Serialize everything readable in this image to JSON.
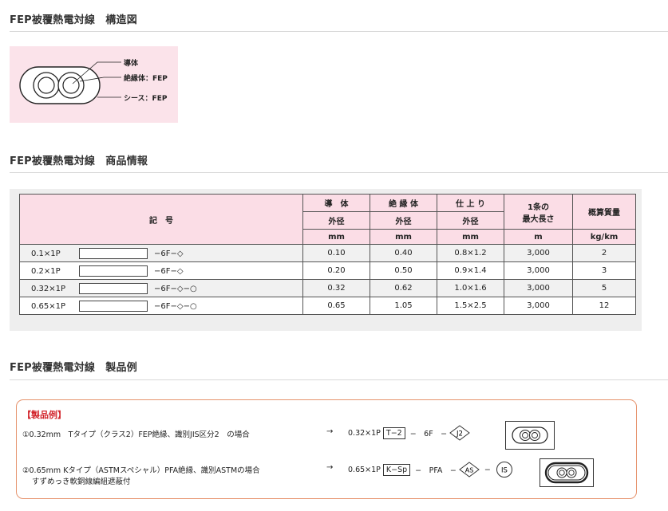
{
  "sections": {
    "structure_title": "FEP被覆熱電対線　構造図",
    "product_info_title": "FEP被覆熱電対線　商品情報",
    "example_title": "FEP被覆熱電対線　製品例"
  },
  "diagram": {
    "labels": [
      "導体",
      "絶縁体：FEP",
      "シース：FEP"
    ]
  },
  "table": {
    "symbol_header": "記　号",
    "col_headers": [
      {
        "top": "導　体",
        "sub": "外径",
        "unit": "mm"
      },
      {
        "top": "絶 縁 体",
        "sub": "外径",
        "unit": "mm"
      },
      {
        "top": "仕 上 り",
        "sub": "外径",
        "unit": "mm"
      },
      {
        "top": "1条の",
        "sub": "最大長さ",
        "unit": "m"
      },
      {
        "top": "概算質量",
        "sub": "",
        "unit": "kg/km"
      }
    ],
    "rows": [
      {
        "size": "0.1×1P",
        "code": "−6F−◇",
        "cond": "0.10",
        "ins": "0.40",
        "finish": "0.8×1.2",
        "length": "3,000",
        "mass": "2"
      },
      {
        "size": "0.2×1P",
        "code": "−6F−◇",
        "cond": "0.20",
        "ins": "0.50",
        "finish": "0.9×1.4",
        "length": "3,000",
        "mass": "3"
      },
      {
        "size": "0.32×1P",
        "code": "−6F−◇−○",
        "cond": "0.32",
        "ins": "0.62",
        "finish": "1.0×1.6",
        "length": "3,000",
        "mass": "5"
      },
      {
        "size": "0.65×1P",
        "code": "−6F−◇−○",
        "cond": "0.65",
        "ins": "1.05",
        "finish": "1.5×2.5",
        "length": "3,000",
        "mass": "12"
      }
    ]
  },
  "example": {
    "heading": "【製品例】",
    "item1": {
      "text": "①0.32mm　Tタイプ（クラス2）FEP絶縁、識別JIS区分2　の場合",
      "arrow": "→",
      "size": "0.32×1P",
      "type_box": "T−2",
      "mid": "−　6F　−",
      "diamond": "J2"
    },
    "item2": {
      "text": "②0.65mm Kタイプ（ASTMスペシャル）PFA絶縁、識別ASTMの場合",
      "text2": "すずめっき軟銅線編組遮蔽付",
      "arrow": "→",
      "size": "0.65×1P",
      "type_box": "K−Sp",
      "mid": "−　PFA　−",
      "diamond": "AS",
      "dash": "−",
      "circle": "IS"
    }
  },
  "colors": {
    "pink_bg": "#fbe3ea",
    "header_pink": "#fbdde6",
    "accent_red": "#d2232a",
    "example_border": "#e6936d"
  }
}
